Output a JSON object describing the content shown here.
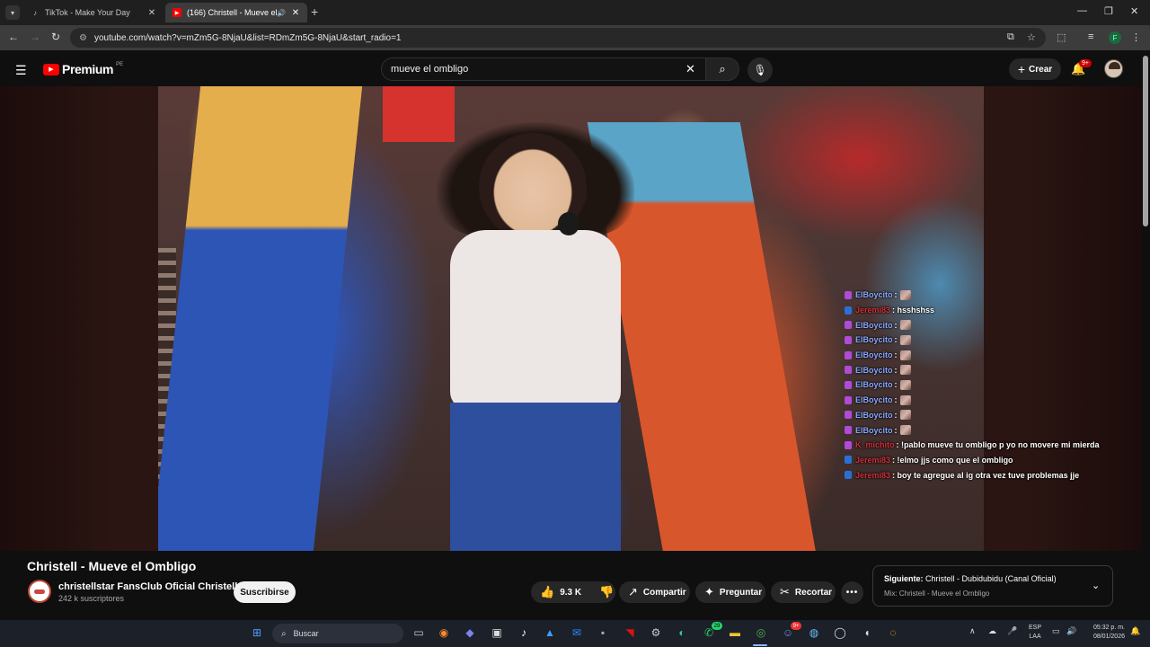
{
  "browser": {
    "tabs": [
      {
        "title": "TikTok - Make Your Day",
        "icon": "tiktok-icon",
        "active": false
      },
      {
        "title": "(166) Christell - Mueve el O",
        "icon": "youtube-icon",
        "active": true
      }
    ],
    "url": "youtube.com/watch?v=mZm5G-8NjaU&list=RDmZm5G-8NjaU&start_radio=1",
    "profile_initial": "F"
  },
  "youtube": {
    "logo_text": "Premium",
    "region": "PE",
    "search_value": "mueve el ombligo",
    "create_label": "Crear",
    "notifications_badge": "9+"
  },
  "chat_overlay": [
    {
      "user": "ElBoycito",
      "text": ":",
      "emote": true,
      "user_color": "#8aa8ff",
      "icon_color": "#b04ad8"
    },
    {
      "user": "Jeremi83",
      "text": ": hsshshss",
      "emote": false,
      "user_color": "#d0303a",
      "icon_color": "#2b6fd6"
    },
    {
      "user": "ElBoycito",
      "text": ":",
      "emote": true,
      "user_color": "#8aa8ff",
      "icon_color": "#b04ad8"
    },
    {
      "user": "ElBoycito",
      "text": ":",
      "emote": true,
      "user_color": "#8aa8ff",
      "icon_color": "#b04ad8"
    },
    {
      "user": "ElBoycito",
      "text": ":",
      "emote": true,
      "user_color": "#8aa8ff",
      "icon_color": "#b04ad8"
    },
    {
      "user": "ElBoycito",
      "text": ":",
      "emote": true,
      "user_color": "#8aa8ff",
      "icon_color": "#b04ad8"
    },
    {
      "user": "ElBoycito",
      "text": ":",
      "emote": true,
      "user_color": "#8aa8ff",
      "icon_color": "#b04ad8"
    },
    {
      "user": "ElBoycito",
      "text": ":",
      "emote": true,
      "user_color": "#8aa8ff",
      "icon_color": "#b04ad8"
    },
    {
      "user": "ElBoycito",
      "text": ":",
      "emote": true,
      "user_color": "#8aa8ff",
      "icon_color": "#b04ad8"
    },
    {
      "user": "ElBoycito",
      "text": ":",
      "emote": true,
      "user_color": "#8aa8ff",
      "icon_color": "#b04ad8"
    },
    {
      "user": "K_michito",
      "text": ": !pablo mueve tu ombligo p yo no movere mi mierda",
      "emote": false,
      "user_color": "#d0303a",
      "icon_color": "#b04ad8"
    },
    {
      "user": "Jeremi83",
      "text": ": !elmo jjs como que el ombligo",
      "emote": false,
      "user_color": "#d0303a",
      "icon_color": "#2b6fd6"
    },
    {
      "user": "Jeremi83",
      "text": ": boy te agregue al ig otra vez tuve problemas jje",
      "emote": false,
      "user_color": "#d0303a",
      "icon_color": "#2b6fd6"
    }
  ],
  "video": {
    "title": "Christell - Mueve el Ombligo",
    "channel": "christellstar FansClub Oficial Christell",
    "subscribers": "242 k suscriptores",
    "subscribe_label": "Suscribirse",
    "likes": "9.3 K",
    "share_label": "Compartir",
    "ask_label": "Preguntar",
    "clip_label": "Recortar",
    "more_label": "•••"
  },
  "up_next": {
    "prefix": "Siguiente:",
    "title": "Christell - Dubidubidu (Canal Oficial)",
    "subtitle": "Mix: Christell - Mueve el Ombligo"
  },
  "taskbar": {
    "search_placeholder": "Buscar",
    "lang_1": "ESP",
    "lang_2": "LAA",
    "time": "05:32 p. m.",
    "date": "08/01/2026",
    "whatsapp_badge": "29",
    "discord_badge": "9+"
  },
  "colors": {
    "youtube_red": "#ff0000",
    "background": "#0f0f0f"
  }
}
